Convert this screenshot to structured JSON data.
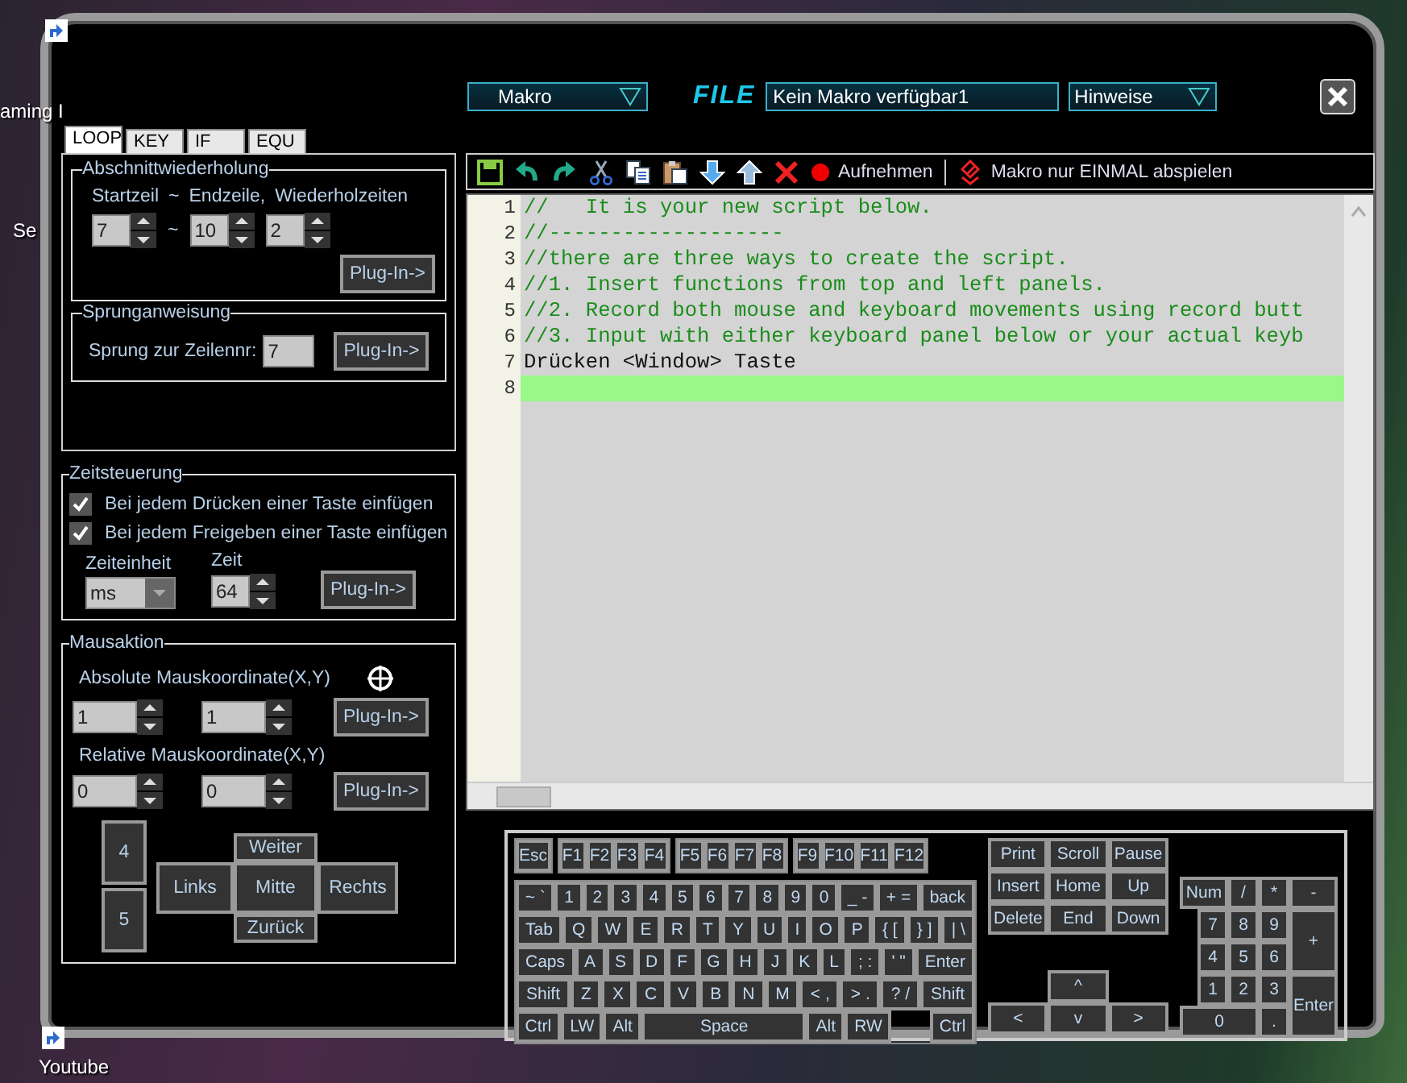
{
  "desktop": {
    "icons": [
      {
        "label": "aming I"
      },
      {
        "label": "Se"
      },
      {
        "label": "Youtube"
      }
    ]
  },
  "header": {
    "mode_dropdown": "Makro",
    "file_label": "FILE",
    "macro_name": "Kein Makro verfügbar1",
    "hint_dropdown": "Hinweise"
  },
  "tabs": [
    {
      "label": "LOOP",
      "selected": true
    },
    {
      "label": "KEY",
      "selected": false
    },
    {
      "label": "IF",
      "selected": false
    },
    {
      "label": "EQU",
      "selected": false
    }
  ],
  "loop": {
    "title": "Abschnittwiederholung",
    "labels": [
      "Startzeil",
      "~",
      "Endzeile,",
      "Wiederholzeiten"
    ],
    "start": "7",
    "separator": "~",
    "end": "10",
    "repeat": "2",
    "button": "Plug-In->"
  },
  "jump": {
    "title": "Sprunganweisung",
    "label": "Sprung zur Zeilennr:",
    "value": "7",
    "button": "Plug-In->"
  },
  "timing": {
    "title": "Zeitsteuerung",
    "options": [
      {
        "label": "Bei jedem Drücken einer Taste einfügen",
        "checked": true
      },
      {
        "label": "Bei jedem Freigeben einer Taste einfügen",
        "checked": true
      }
    ],
    "unit_label": "Zeiteinheit",
    "unit": "ms",
    "time_label": "Zeit",
    "time": "64",
    "button": "Plug-In->"
  },
  "mouse": {
    "title": "Mausaktion",
    "absolute_label": "Absolute Mauskoordinate(X,Y)",
    "absolute": [
      "1",
      "1"
    ],
    "absolute_button": "Plug-In->",
    "relative_label": "Relative Mauskoordinate(X,Y)",
    "relative": [
      "0",
      "0"
    ],
    "relative_button": "Plug-In->",
    "side_buttons": [
      "4",
      "5"
    ],
    "pad": {
      "up": "Weiter",
      "left": "Links",
      "center": "Mitte",
      "right": "Rechts",
      "down": "Zurück"
    }
  },
  "toolbar": {
    "record": "Aufnehmen",
    "play_once": "Makro nur EINMAL abspielen"
  },
  "editor": {
    "lines": [
      {
        "number": "1",
        "text": "//   It is your new script below.",
        "kind": "comment",
        "current": false
      },
      {
        "number": "2",
        "text": "//-------------------",
        "kind": "comment",
        "current": false
      },
      {
        "number": "3",
        "text": "//there are three ways to create the script.",
        "kind": "comment",
        "current": false
      },
      {
        "number": "4",
        "text": "//1. Insert functions from top and left panels.",
        "kind": "comment",
        "current": false
      },
      {
        "number": "5",
        "text": "//2. Record both mouse and keyboard movements using record butt",
        "kind": "comment",
        "current": false
      },
      {
        "number": "6",
        "text": "//3. Input with either keyboard panel below or your actual keyb",
        "kind": "comment",
        "current": false
      },
      {
        "number": "7",
        "text": "Drücken <Window> Taste",
        "kind": "code",
        "current": false
      },
      {
        "number": "8",
        "kind": "code",
        "current": true
      }
    ]
  },
  "keyboard": {
    "function_groups": [
      [
        "Esc"
      ],
      [
        "F1",
        "F2",
        "F3",
        "F4"
      ],
      [
        "F5",
        "F6",
        "F7",
        "F8"
      ],
      [
        "F9",
        "F10",
        "F11",
        "F12"
      ]
    ],
    "main_rows": [
      [
        "~ `",
        "1",
        "2",
        "3",
        "4",
        "5",
        "6",
        "7",
        "8",
        "9",
        "0",
        "_ -",
        "+ =",
        "back"
      ],
      [
        "Tab",
        "Q",
        "W",
        "E",
        "R",
        "T",
        "Y",
        "U",
        "I",
        "O",
        "P",
        "{ [",
        "} ]",
        "| \\"
      ],
      [
        "Caps",
        "A",
        "S",
        "D",
        "F",
        "G",
        "H",
        "J",
        "K",
        "L",
        "; :",
        "' \"",
        "Enter"
      ],
      [
        "Shift",
        "Z",
        "X",
        "C",
        "V",
        "B",
        "N",
        "M",
        "< ,",
        "> .",
        "? /",
        "Shift"
      ],
      [
        "Ctrl",
        "LW",
        "Alt",
        "Space",
        "Alt",
        "RW",
        "Ctrl"
      ]
    ],
    "system_keys": [
      "Print",
      "Scroll",
      "Pause"
    ],
    "nav_rows": [
      [
        "Insert",
        "Home",
        "Up"
      ],
      [
        "Delete",
        "End",
        "Down"
      ]
    ],
    "arrows": [
      "^",
      "<",
      "v",
      ">"
    ],
    "numpad": [
      "Num",
      "/",
      "*",
      "-",
      "7",
      "8",
      "9",
      "+",
      "4",
      "5",
      "6",
      "1",
      "2",
      "3",
      "Enter",
      "0",
      "."
    ]
  }
}
